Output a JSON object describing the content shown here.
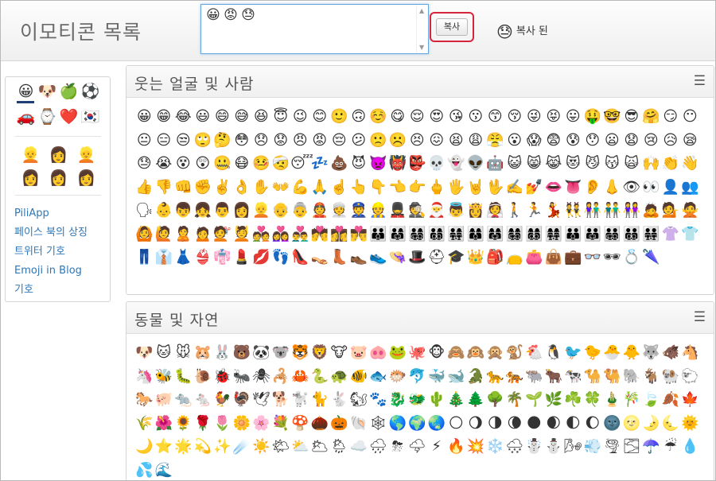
{
  "header": {
    "title": "이모티콘 목록"
  },
  "picker": {
    "selected": [
      "😀",
      "😡",
      "😓"
    ]
  },
  "copy_button": {
    "label": "복사"
  },
  "status": {
    "icon": "😓",
    "text": "복사 된"
  },
  "sidebar": {
    "categories_row1": [
      "😀",
      "🐶",
      "🍏",
      "⚽"
    ],
    "categories_row2": [
      "🚗",
      "⌚",
      "❤️",
      "🇰🇷"
    ],
    "skins_row1": [
      "👱",
      "👩",
      "👱"
    ],
    "skins_row2": [
      "👩",
      "👩",
      "👩"
    ],
    "links": [
      "PiliApp",
      "페이스 북의 상징",
      "트위터 기호",
      "Emoji in Blog",
      "기호"
    ]
  },
  "sections": [
    {
      "title": "웃는 얼굴 및 사람",
      "emojis": [
        "😀",
        "😁",
        "😂",
        "😃",
        "😄",
        "😅",
        "😆",
        "😇",
        "😉",
        "😊",
        "🙂",
        "🙃",
        "☺️",
        "😋",
        "😌",
        "😍",
        "😘",
        "😗",
        "😙",
        "😚",
        "😜",
        "😝",
        "😛",
        "🤑",
        "🤓",
        "😎",
        "🤗",
        "😏",
        "😶",
        "😐",
        "😑",
        "😒",
        "🙄",
        "🤔",
        "😳",
        "😞",
        "😟",
        "😠",
        "😡",
        "😔",
        "😕",
        "🙁",
        "☹️",
        "😣",
        "😖",
        "😫",
        "😩",
        "😤",
        "😮",
        "😱",
        "😨",
        "😰",
        "😯",
        "😦",
        "😧",
        "😢",
        "😥",
        "😪",
        "😓",
        "😭",
        "😵",
        "😲",
        "🤐",
        "😷",
        "🤒",
        "🤕",
        "😴",
        "💤",
        "💩",
        "😈",
        "👿",
        "👹",
        "👺",
        "💀",
        "👻",
        "👽",
        "🤖",
        "😺",
        "😸",
        "😹",
        "😻",
        "😼",
        "😽",
        "🙀",
        "🙌",
        "👏",
        "👋",
        "👍",
        "👎",
        "👊",
        "✊",
        "✌️",
        "👌",
        "✋",
        "👐",
        "💪",
        "🙏",
        "☝️",
        "👆",
        "👇",
        "👈",
        "👉",
        "🖕",
        "🖐",
        "🤘",
        "🖖",
        "✍️",
        "💅",
        "👄",
        "👅",
        "👂",
        "👃",
        "👁",
        "👀",
        "👤",
        "👥",
        "🗣",
        "👶",
        "👦",
        "👧",
        "👨",
        "👩",
        "👱",
        "👴",
        "👵",
        "👲",
        "👳",
        "👮",
        "👷",
        "💂",
        "🕵",
        "🎅",
        "👼",
        "👸",
        "👰",
        "🚶",
        "🏃",
        "💃",
        "👯",
        "👫",
        "👬",
        "👭",
        "🙇",
        "💁",
        "🙅",
        "🙆",
        "🙋",
        "🙎",
        "🙍",
        "💇",
        "💆",
        "💑",
        "👩‍❤️‍👩",
        "👨‍❤️‍👨",
        "💏",
        "👩‍❤️‍💋‍👩",
        "👨‍❤️‍💋‍👨",
        "👪",
        "👨‍👩‍👧",
        "👨‍👩‍👧‍👦",
        "👨‍👩‍👦‍👦",
        "👨‍👩‍👧‍👧",
        "👩‍👩‍👦",
        "👩‍👩‍👧",
        "👩‍👩‍👧‍👦",
        "👩‍👩‍👦‍👦",
        "👩‍👩‍👧‍👧",
        "👨‍👨‍👦",
        "👨‍👨‍👧",
        "👨‍👨‍👧‍👦",
        "👨‍👨‍👦‍👦",
        "👨‍👨‍👧‍👧",
        "👚",
        "👕",
        "👖",
        "👔",
        "👗",
        "👙",
        "👘",
        "💄",
        "💋",
        "👣",
        "👠",
        "👡",
        "👢",
        "👞",
        "👟",
        "👒",
        "🎩",
        "⛑",
        "🎓",
        "👑",
        "🎒",
        "👝",
        "👛",
        "👜",
        "💼",
        "👓",
        "🕶",
        "💍",
        "🌂"
      ]
    },
    {
      "title": "동물 및 자연",
      "emojis": [
        "🐶",
        "🐱",
        "🐭",
        "🐹",
        "🐰",
        "🐻",
        "🐼",
        "🐨",
        "🐯",
        "🦁",
        "🐮",
        "🐷",
        "🐽",
        "🐸",
        "🐙",
        "🐵",
        "🙈",
        "🙉",
        "🙊",
        "🐒",
        "🐔",
        "🐧",
        "🐦",
        "🐤",
        "🐣",
        "🐥",
        "🐺",
        "🐗",
        "🐴",
        "🦄",
        "🐝",
        "🐛",
        "🐌",
        "🐞",
        "🐜",
        "🕷",
        "🦂",
        "🦀",
        "🐍",
        "🐢",
        "🐠",
        "🐟",
        "🐡",
        "🐬",
        "🐳",
        "🐋",
        "🐊",
        "🐆",
        "🐅",
        "🐃",
        "🐂",
        "🐄",
        "🐪",
        "🐫",
        "🐘",
        "🐐",
        "🐏",
        "🐑",
        "🐎",
        "🐖",
        "🐀",
        "🐁",
        "🐓",
        "🦃",
        "🕊",
        "🐕",
        "🐩",
        "🐈",
        "🐇",
        "🐿",
        "🐾",
        "🐉",
        "🐲",
        "🌵",
        "🎄",
        "🌲",
        "🌳",
        "🌴",
        "🌱",
        "🌿",
        "☘️",
        "🍀",
        "🎍",
        "🎋",
        "🍃",
        "🍂",
        "🍁",
        "🌾",
        "🌺",
        "🌻",
        "🌹",
        "🌷",
        "🌼",
        "🌸",
        "💐",
        "🍄",
        "🌰",
        "🎃",
        "🐚",
        "🕸",
        "🌎",
        "🌍",
        "🌏",
        "🌕",
        "🌖",
        "🌗",
        "🌘",
        "🌑",
        "🌒",
        "🌓",
        "🌔",
        "🌚",
        "🌝",
        "🌛",
        "🌜",
        "🌞",
        "🌙",
        "⭐",
        "🌟",
        "💫",
        "✨",
        "☄️",
        "☀️",
        "🌤",
        "⛅",
        "🌥",
        "🌦",
        "☁️",
        "🌧",
        "⛈",
        "🌩",
        "⚡",
        "🔥",
        "💥",
        "❄️",
        "🌨",
        "☃️",
        "⛄",
        "🌬",
        "💨",
        "🌪",
        "🌫",
        "☂️",
        "☔",
        "💧",
        "💦",
        "🌊"
      ]
    }
  ]
}
